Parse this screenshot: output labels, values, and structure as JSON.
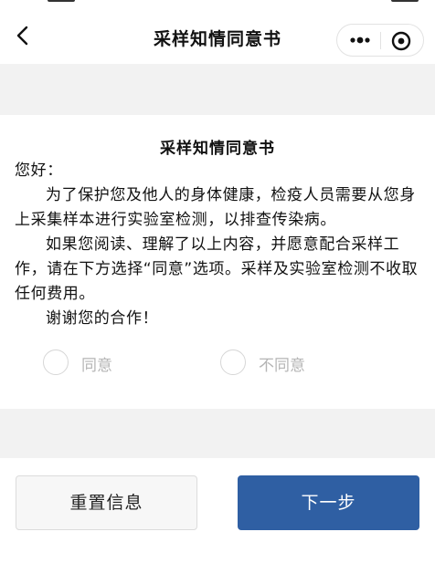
{
  "nav": {
    "title": "采样知情同意书"
  },
  "icons": {
    "back": "chevron-left-icon",
    "more": "more-dots-icon",
    "close": "target-circle-icon"
  },
  "document": {
    "title": "采样知情同意书",
    "greeting": "您好：",
    "paragraph_1": "为了保护您及他人的身体健康，检疫人员需要从您身上采集样本进行实验室检测，以排查传染病。",
    "paragraph_2": "如果您阅读、理解了以上内容，并愿意配合采样工作，请在下方选择“同意”选项。采样及实验室检测不收取任何费用。",
    "thanks": "谢谢您的合作！"
  },
  "options": {
    "agree_label": "同意",
    "disagree_label": "不同意",
    "agree_selected": false,
    "disagree_selected": false
  },
  "buttons": {
    "reset_label": "重置信息",
    "next_label": "下一步"
  },
  "colors": {
    "primary": "#2f5fa3",
    "background_gray": "#f2f2f2",
    "option_text": "#b5b5b5"
  }
}
